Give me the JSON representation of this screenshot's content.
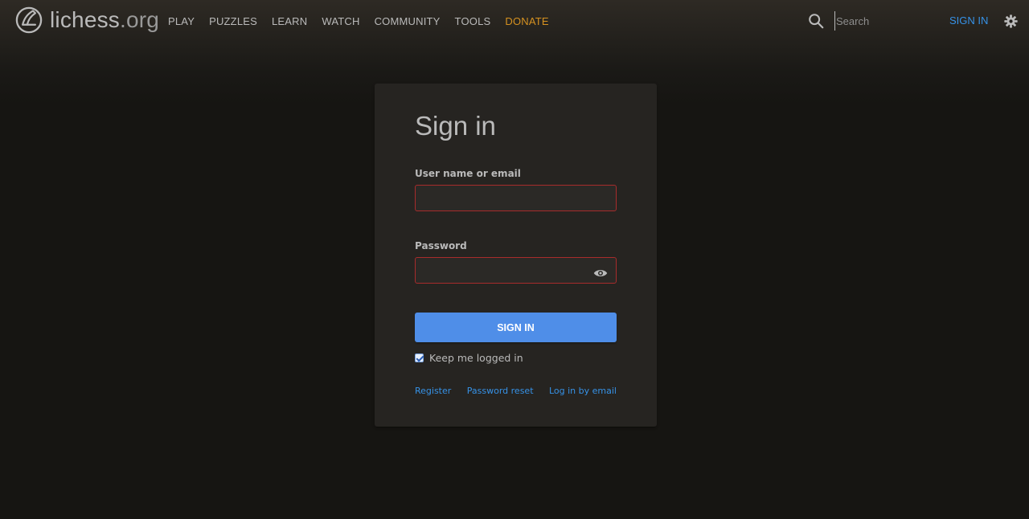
{
  "header": {
    "logo": {
      "name": "lichess",
      "tld": ".org"
    },
    "nav": [
      "PLAY",
      "PUZZLES",
      "LEARN",
      "WATCH",
      "COMMUNITY",
      "TOOLS",
      "DONATE"
    ],
    "search": {
      "placeholder": "Search",
      "value": ""
    },
    "signin_label": "SIGN IN",
    "icons": {
      "search": "search-icon",
      "settings": "gear-icon"
    }
  },
  "login": {
    "title": "Sign in",
    "username_label": "User name or email",
    "username_value": "",
    "password_label": "Password",
    "password_value": "",
    "submit_label": "SIGN IN",
    "remember_label": "Keep me logged in",
    "remember_checked": true,
    "links": [
      "Register",
      "Password reset",
      "Log in by email"
    ]
  },
  "colors": {
    "background": "#161512",
    "card": "#262421",
    "accent": "#3692e7",
    "button": "#4f8ee8",
    "donate": "#d59120",
    "error_border": "#a82c2c"
  }
}
